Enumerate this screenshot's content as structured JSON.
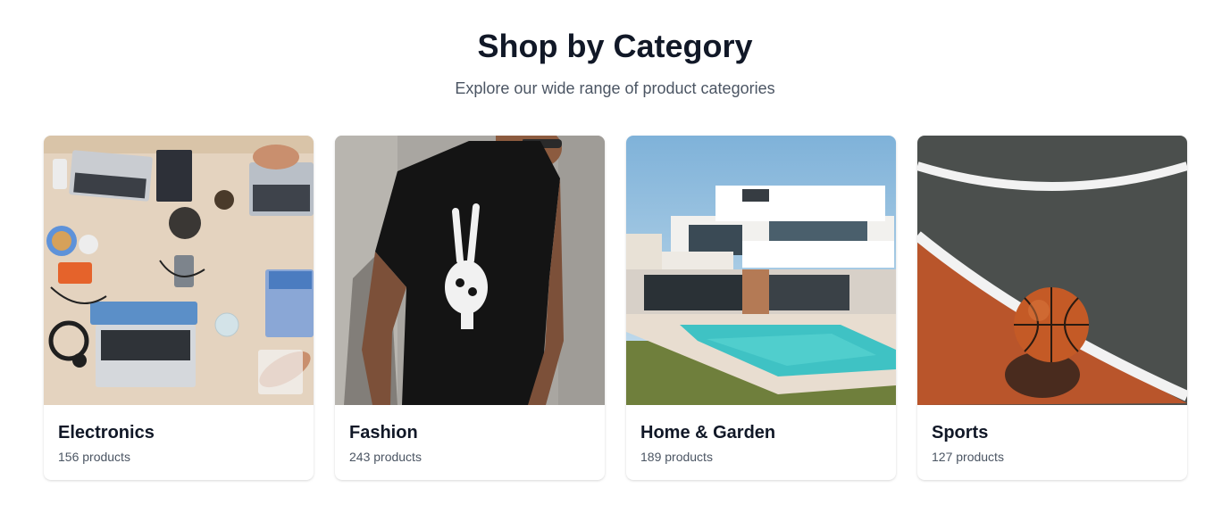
{
  "header": {
    "title": "Shop by Category",
    "subtitle": "Explore our wide range of product categories"
  },
  "categories": [
    {
      "name": "Electronics",
      "count": "156 products",
      "image": "laptops-on-desk-photo"
    },
    {
      "name": "Fashion",
      "count": "243 products",
      "image": "man-in-black-tshirt-photo"
    },
    {
      "name": "Home & Garden",
      "count": "189 products",
      "image": "modern-house-with-pool-photo"
    },
    {
      "name": "Sports",
      "count": "127 products",
      "image": "basketball-on-court-photo"
    }
  ]
}
